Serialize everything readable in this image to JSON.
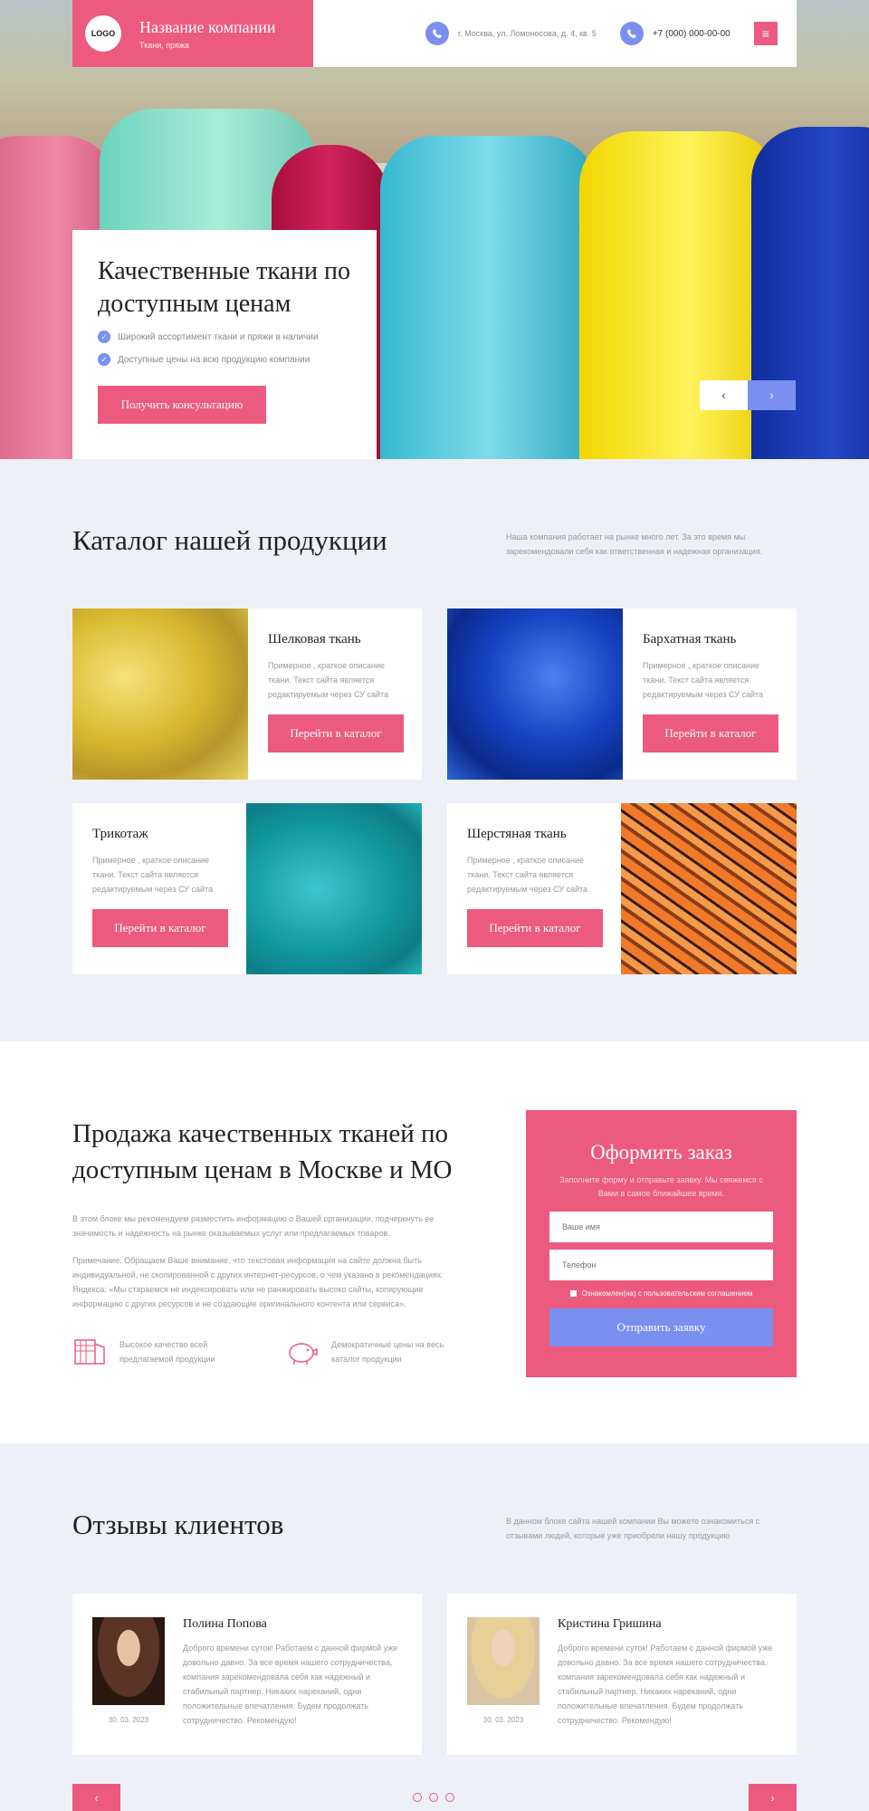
{
  "header": {
    "logo": "LOGO",
    "company_name": "Название компании",
    "company_sub": "Ткани, пряжа",
    "address": "г. Москва, ул. Ломоносова, д. 4, кв. 5",
    "phone": "+7 (000) 000-00-00",
    "menu_icon": "menu-icon",
    "accent": "#ec5a7e",
    "secondary": "#7b8ff0"
  },
  "hero": {
    "title": "Качественные ткани по доступным ценам",
    "bullets": [
      "Широкий ассортимент ткани и пряжи в наличии",
      "Доступные цены на всю продукцию компании"
    ],
    "button": "Получить консультацию",
    "prev": "‹",
    "next": "›"
  },
  "catalog": {
    "title": "Каталог нашей продукции",
    "description": "Наша компания работает на рынке много лет. За это время мы зарекомендовали себя как ответственная и надежная организация.",
    "cards": [
      {
        "title": "Шелковая ткань",
        "text": "Примерное , краткое описание ткани. Текст сайта является редактируемым через СУ сайта",
        "button": "Перейти в каталог"
      },
      {
        "title": "Бархатная ткань",
        "text": "Примерное , краткое описание ткани. Текст сайта является редактируемым через СУ сайта",
        "button": "Перейти в каталог"
      },
      {
        "title": "Трикотаж",
        "text": "Примерное , краткое описание ткани. Текст сайта является редактируемым через СУ сайта",
        "button": "Перейти в каталог"
      },
      {
        "title": "Шерстяная ткань",
        "text": "Примерное , краткое описание ткани. Текст сайта является редактируемым через СУ сайта",
        "button": "Перейти в каталог"
      }
    ]
  },
  "order": {
    "title": "Продажа качественных тканей по доступным ценам в Москве и МО",
    "p1": "В этом блоке мы рекомендуем разместить информацию о Вашей организации, подчеркнуть ее значимость и надежность на рынке оказываемых услуг или предлагаемых товаров.",
    "p2": "Примечание. Обращаем Ваше внимание, что текстовая информация на сайте должна быть индивидуальной, не скопированной с других интернет-ресурсов, о чем указано в рекомендациях Яндекса: «Мы стараемся не индексировать или не ранжировать высоко сайты, копирующие информацию с других ресурсов и не создающие оригинального контента или сервиса».",
    "features": [
      {
        "icon": "fabric-icon",
        "text": "Высокое качество всей предлагаемой продукции"
      },
      {
        "icon": "piggy-bank-icon",
        "text": "Демократичные цены на весь каталог продукции"
      }
    ],
    "form": {
      "title": "Оформить заказ",
      "subtitle": "Заполните форму и отправьте заявку. Мы свяжемся с Вами в самое ближайшее время.",
      "name_placeholder": "Ваше имя",
      "phone_placeholder": "Телефон",
      "agree": "Ознакомлен(на) с пользовательским соглашением",
      "submit": "Отправить заявку"
    }
  },
  "reviews": {
    "title": "Отзывы клиентов",
    "description": "В данном блоке сайта нашей компании Вы можете ознакомиться с отзывами людей, которые уже приобрели нашу продукцию",
    "items": [
      {
        "name": "Полина Попова",
        "date": "30. 03. 2023",
        "text": "Доброго времени суток! Работаем с данной фирмой уже довольно давно. За все время нашего сотрудничества, компания зарекомендовала себя как надежный и стабильный партнер. Никаких нареканий, одни положительные впечатления. Будем продолжать сотрудничество. Рекомендую!"
      },
      {
        "name": "Кристина Гришина",
        "date": "30. 03. 2023",
        "text": "Доброго времени суток! Работаем с данной фирмой уже довольно давно. За все время нашего сотрудничества, компания зарекомендовала себя как надежный и стабильный партнер. Никаких нареканий, одни положительные впечатления. Будем продолжать сотрудничество. Рекомендую!"
      }
    ],
    "prev": "‹",
    "next": "›"
  }
}
